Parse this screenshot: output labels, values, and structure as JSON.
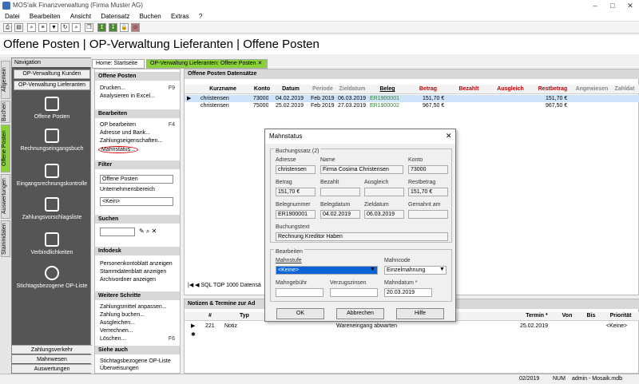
{
  "window": {
    "title": "MOS'aik Finanzverwaltung (Firma Muster AG)"
  },
  "menu": [
    "Datei",
    "Bearbeiten",
    "Ansicht",
    "Datensatz",
    "Buchen",
    "Extras",
    "?"
  ],
  "page_title": "Offene Posten | OP-Verwaltung Lieferanten | Offene Posten",
  "vertical_tabs": [
    "Allgemein",
    "Buchen",
    "Offene Posten",
    "Auswertungen",
    "Stammdaten"
  ],
  "nav": {
    "header": "Navigation",
    "buttons": [
      "OP-Verwaltung Kunden",
      "OP-Verwaltung Lieferanten"
    ],
    "items": [
      "Offene Posten",
      "Rechnungseingangsbuch",
      "Eingangsrechnungskontrolle",
      "Zahlungsvorschlagsliste",
      "Verbindlichkeiten",
      "Stichtagsbezogene OP-Liste"
    ],
    "footer": [
      "Zahlungsverkehr",
      "Mahnwesen",
      "Auswertungen"
    ]
  },
  "tabs": [
    "Home: Startseite",
    "OP-Verwaltung Lieferanten: Offene Posten"
  ],
  "actions": {
    "offene_posten": {
      "title": "Offene Posten",
      "items": [
        "Drucken...",
        "Analysieren in Excel..."
      ],
      "shortcut": "F9"
    },
    "bearbeiten": {
      "title": "Bearbeiten",
      "items": [
        "OP bearbeiten",
        "Adresse und Bank...",
        "Zahlungseigenschaften...",
        "Mahnstatus..."
      ],
      "shortcut": "F4"
    },
    "filter": {
      "title": "Filter",
      "select": "Offene Posten",
      "label": "Unternehmensbereich",
      "select2": "<Kein>"
    },
    "suchen": {
      "title": "Suchen"
    },
    "infodesk": {
      "title": "Infodesk",
      "items": [
        "Personenkontoblatt anzeigen",
        "Stammdatenblatt anzeigen",
        "Archivordner anzeigen"
      ]
    },
    "weitere": {
      "title": "Weitere Schritte",
      "items": [
        "Zahlungsmittel anpassen...",
        "Zahlung buchen...",
        "Ausgleichen...",
        "Verrechnen...",
        "Löschen..."
      ],
      "shortcut": "F6"
    },
    "siehe": {
      "title": "Siehe auch",
      "items": [
        "Stichtagsbezogene OP-Liste",
        "Überweisungen"
      ]
    }
  },
  "grid": {
    "title": "Offene Posten Datensätze",
    "columns": [
      "Kurzname",
      "Konto",
      "Datum",
      "Periode",
      "Zieldatum",
      "Beleg",
      "Betrag",
      "Bezahlt",
      "Ausgleich",
      "Restbetrag",
      "Angewiesen",
      "Zahldat"
    ],
    "rows": [
      [
        "christensen",
        "73000",
        "04.02.2019",
        "Feb 2019",
        "06.03.2019",
        "ER1900001",
        "151,70 €",
        "",
        "",
        "151,70 €",
        "",
        ""
      ],
      [
        "christensen",
        "75000",
        "25.02.2019",
        "Feb 2019",
        "27.03.2019",
        "ER1900002",
        "967,50 €",
        "",
        "",
        "967,50 €",
        "",
        ""
      ]
    ],
    "footer": "SQL TOP 1000 Datensä"
  },
  "notes": {
    "title": "Notizen & Termine zur Ad",
    "columns": [
      "#",
      "Typ",
      "Termin *",
      "Von",
      "Bis",
      "Priorität"
    ],
    "row": [
      "221",
      "Notiz",
      "Wareneingang abwarten",
      "25.02.2019",
      "",
      "",
      "<Keine>"
    ]
  },
  "status": {
    "period": "02/2019",
    "num": "NUM",
    "user": "admin - Mosaik.mdb"
  },
  "dialog": {
    "title": "Mahnstatus",
    "group1": "Buchungssatz (2)",
    "labels": {
      "adresse": "Adresse",
      "name": "Name",
      "konto": "Konto",
      "betrag": "Betrag",
      "bezahlt": "Bezahlt",
      "ausgleich": "Ausgleich",
      "restbetrag": "Restbetrag",
      "belegnummer": "Belegnummer",
      "belegdatum": "Belegdatum",
      "zieldatum": "Zieldatum",
      "gemahnt": "Gemahnt am",
      "buchungstext": "Buchungstext"
    },
    "values": {
      "adresse": "christensen",
      "name": "Firma Cosima Christensen",
      "konto": "73000",
      "betrag": "151,70 €",
      "restbetrag": "151,70 €",
      "belegnummer": "ER1900001",
      "belegdatum": "04.02.2019",
      "zieldatum": "06.03.2019",
      "buchungstext": "Rechnung Kreditor Haben"
    },
    "group2": "Bearbeiten",
    "edit_labels": {
      "mahnstufe": "Mahnstufe",
      "mahncode": "Mahncode",
      "mahngebuehr": "Mahngebühr",
      "verzugszinsen": "Verzugszinsen",
      "mahndatum": "Mahndatum *"
    },
    "edit_values": {
      "mahnstufe": "<Keine>",
      "mahncode": "Einzelmahnung",
      "mahndatum": "20.03.2019"
    },
    "buttons": {
      "ok": "OK",
      "cancel": "Abbrechen",
      "help": "Hilfe"
    }
  },
  "colors": {
    "accent": "#8bd13a",
    "selected_row": "#cfe3fb",
    "nav_bg": "#555555"
  }
}
